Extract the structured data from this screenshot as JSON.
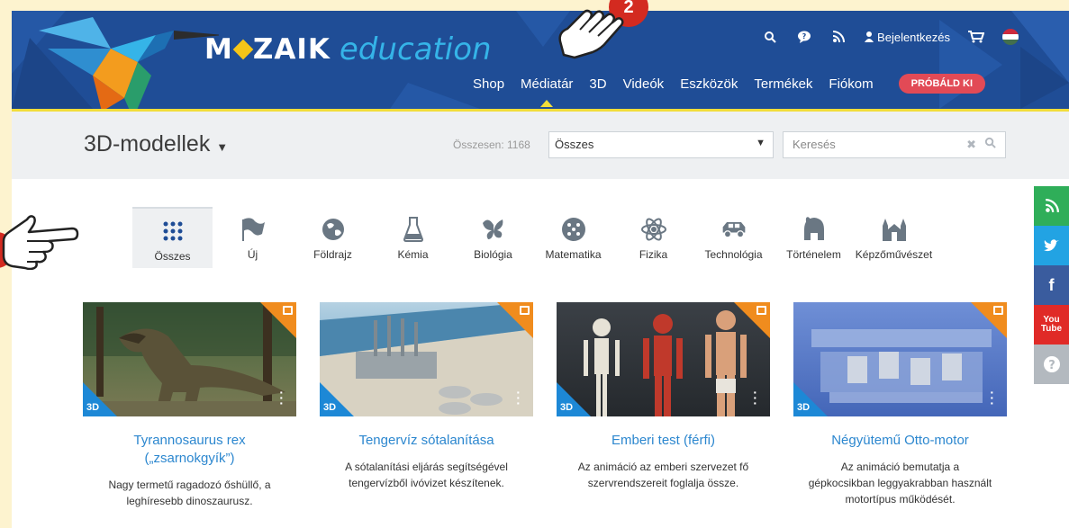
{
  "header": {
    "logo_bold": "M",
    "logo_bold_2": "ZAIK",
    "logo_italic": "education",
    "login_label": "Bejelentkezés",
    "nav": [
      {
        "label": "Shop"
      },
      {
        "label": "Médiatár"
      },
      {
        "label": "3D"
      },
      {
        "label": "Videók"
      },
      {
        "label": "Eszközök"
      },
      {
        "label": "Termékek"
      },
      {
        "label": "Fiókom"
      }
    ],
    "try_label": "PRÓBÁLD KI"
  },
  "subheader": {
    "title": "3D-modellek",
    "total": "Összesen: 1168",
    "select_value": "Összes",
    "search_placeholder": "Keresés"
  },
  "categories": [
    {
      "label": "Összes",
      "icon": "grid-icon"
    },
    {
      "label": "Új",
      "icon": "flag-icon"
    },
    {
      "label": "Földrajz",
      "icon": "globe-icon"
    },
    {
      "label": "Kémia",
      "icon": "flask-icon"
    },
    {
      "label": "Biológia",
      "icon": "butterfly-icon"
    },
    {
      "label": "Matematika",
      "icon": "dice-icon"
    },
    {
      "label": "Fizika",
      "icon": "atom-icon"
    },
    {
      "label": "Technológia",
      "icon": "car-icon"
    },
    {
      "label": "Történelem",
      "icon": "helmet-icon"
    },
    {
      "label": "Képzőművészet",
      "icon": "cathedral-icon"
    }
  ],
  "cards": [
    {
      "badge": "3D",
      "title_line1": "Tyrannosaurus rex",
      "title_line2": "(„zsarnokgyík”)",
      "desc_line1": "Nagy termetű ragadozó őshüllő, a",
      "desc_line2": "leghíresebb dinoszaurusz.",
      "desc_line3": ""
    },
    {
      "badge": "3D",
      "title_line1": "Tengervíz sótalanítása",
      "title_line2": "",
      "desc_line1": "A sótalanítási eljárás segítségével",
      "desc_line2": "tengervízből ivóvizet készítenek.",
      "desc_line3": ""
    },
    {
      "badge": "3D",
      "title_line1": "Emberi test (férfi)",
      "title_line2": "",
      "desc_line1": "Az animáció az emberi szervezet fő",
      "desc_line2": "szervrendszereit foglalja össze.",
      "desc_line3": ""
    },
    {
      "badge": "3D",
      "title_line1": "Négyütemű Otto-motor",
      "title_line2": "",
      "desc_line1": "Az animáció bemutatja a",
      "desc_line2": "gépkocsikban leggyakrabban használt",
      "desc_line3": "motortípus működését."
    }
  ],
  "annotation": {
    "step": "2"
  },
  "colors": {
    "header": "#1f4d96",
    "accent": "#f2dd3a",
    "try": "#e24a56",
    "link": "#2c87cf"
  }
}
